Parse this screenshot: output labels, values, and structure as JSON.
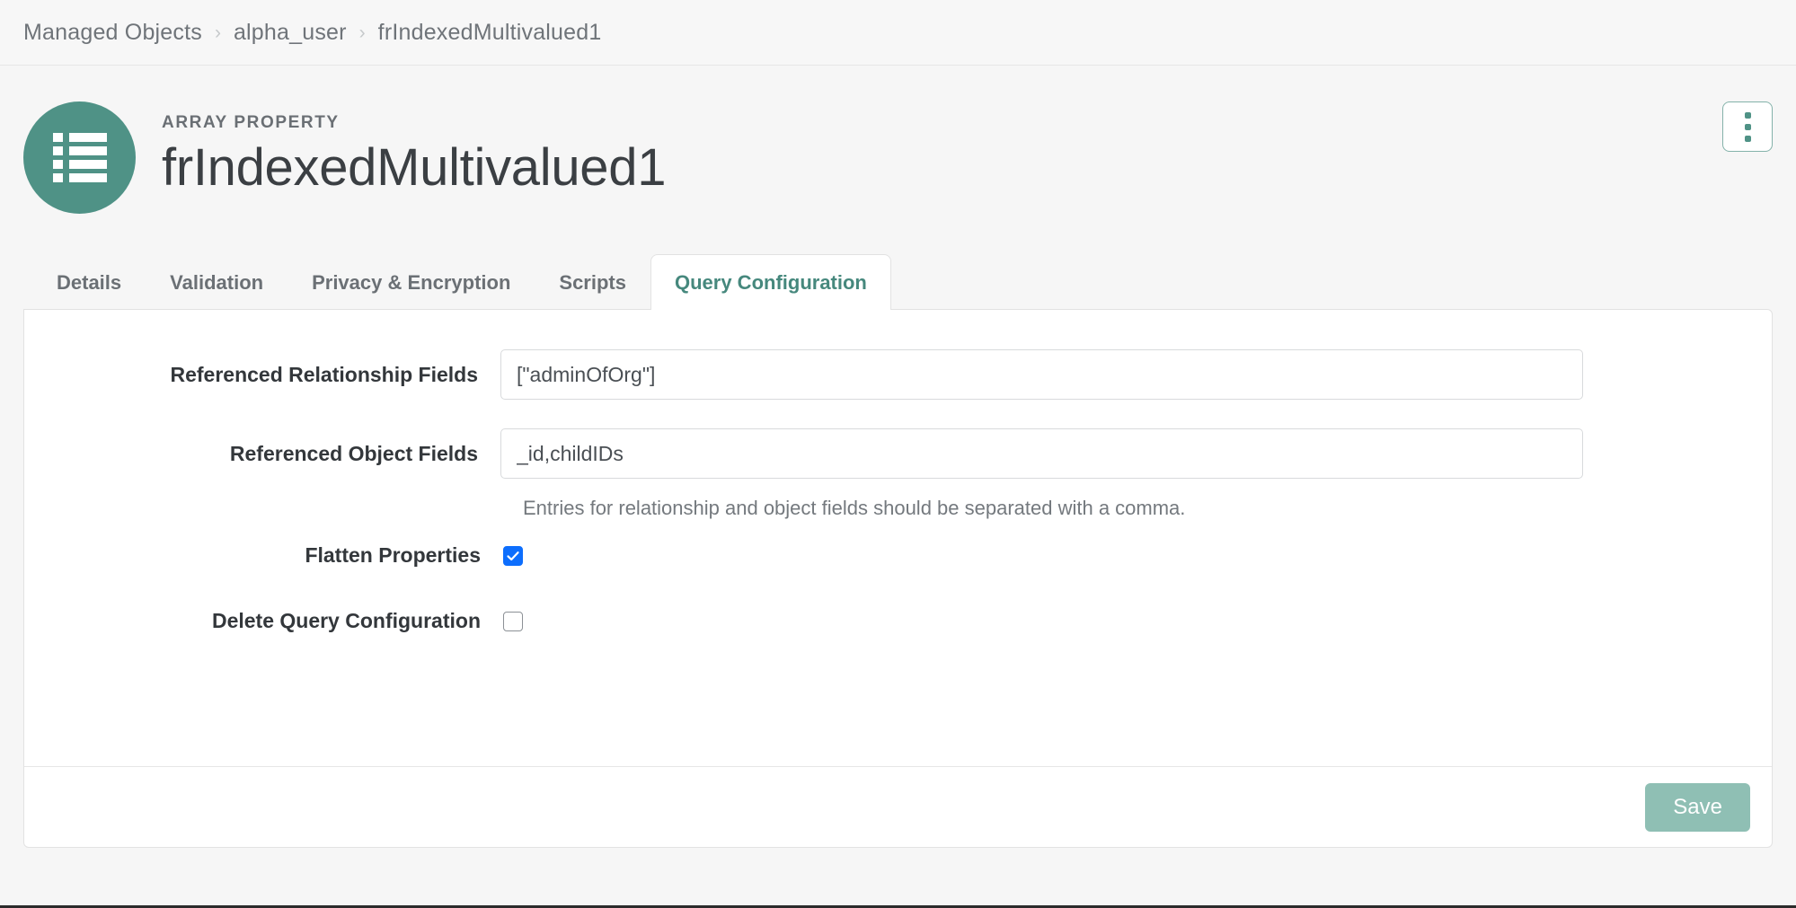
{
  "breadcrumb": {
    "items": [
      "Managed Objects",
      "alpha_user",
      "frIndexedMultivalued1"
    ],
    "separator": "›"
  },
  "header": {
    "eyebrow": "ARRAY PROPERTY",
    "title": "frIndexedMultivalued1",
    "avatar_icon": "list-icon",
    "avatar_color": "#4f9286",
    "menu_icon": "kebab-menu-icon"
  },
  "tabs": [
    {
      "label": "Details",
      "active": false
    },
    {
      "label": "Validation",
      "active": false
    },
    {
      "label": "Privacy & Encryption",
      "active": false
    },
    {
      "label": "Scripts",
      "active": false
    },
    {
      "label": "Query Configuration",
      "active": true
    }
  ],
  "form": {
    "referenced_relationship_fields": {
      "label": "Referenced Relationship Fields",
      "value": "[\"adminOfOrg\"]",
      "placeholder": ""
    },
    "referenced_object_fields": {
      "label": "Referenced Object Fields",
      "value": "_id,childIDs",
      "placeholder": ""
    },
    "help_text": "Entries for relationship and object fields should be separated with a comma.",
    "flatten_properties": {
      "label": "Flatten Properties",
      "checked": true
    },
    "delete_query_configuration": {
      "label": "Delete Query Configuration",
      "checked": false
    }
  },
  "footer": {
    "save_label": "Save"
  },
  "colors": {
    "accent_teal": "#4f9286",
    "tab_active_text": "#46887d",
    "checkbox_blue": "#0d6efd",
    "save_button": "#8fbfb4"
  }
}
